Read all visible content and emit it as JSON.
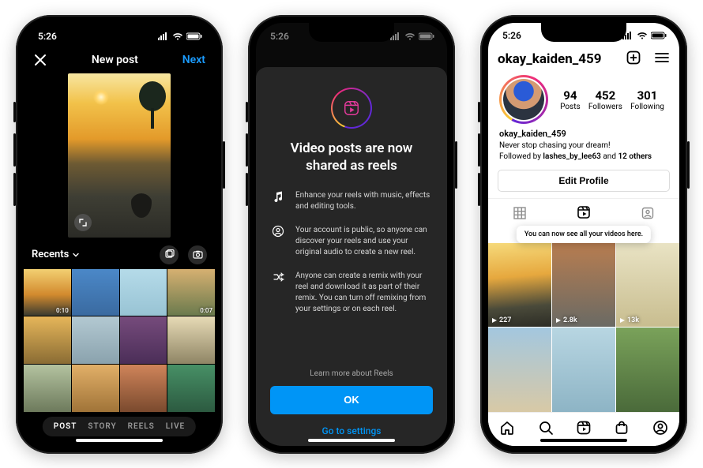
{
  "status_time": "5:26",
  "phone1": {
    "title": "New post",
    "next": "Next",
    "recents_label": "Recents",
    "durations": {
      "t1": "0:10",
      "t4": "0:07"
    },
    "modes": [
      "POST",
      "STORY",
      "REELS",
      "LIVE"
    ],
    "active_mode": "POST"
  },
  "phone2": {
    "heading": "Video posts are now shared as reels",
    "features": [
      "Enhance your reels with music, effects and editing tools.",
      "Your account is public, so anyone can discover your reels and use your original audio to create a new reel.",
      "Anyone can create a remix with your reel and download it as part of their remix. You can turn off remixing from your settings or on each reel."
    ],
    "learn": "Learn more about Reels",
    "ok": "OK",
    "settings": "Go to settings"
  },
  "phone3": {
    "username": "okay_kaiden_459",
    "stats": {
      "posts_n": "94",
      "posts_l": "Posts",
      "followers_n": "452",
      "followers_l": "Followers",
      "following_n": "301",
      "following_l": "Following"
    },
    "bio_name": "okay_kaiden_459",
    "bio_text": "Never stop chasing your dream!",
    "followed_prefix": "Followed by ",
    "followed_user": "lashes_by_lee63",
    "followed_suffix": " and ",
    "followed_others": "12 others",
    "edit": "Edit Profile",
    "tooltip": "You can now see all your videos here.",
    "plays": {
      "a": "227",
      "b": "2.8k",
      "c": "13k"
    }
  }
}
